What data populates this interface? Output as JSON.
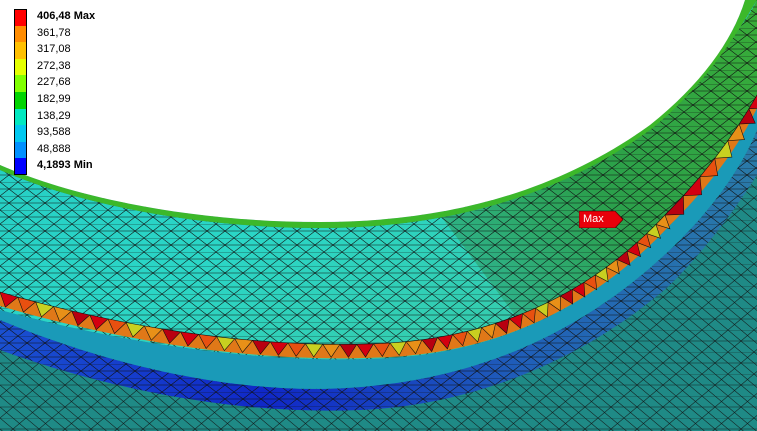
{
  "legend": {
    "entries": [
      {
        "label": "406,48 Max",
        "color": "#ff0000",
        "bold": true
      },
      {
        "label": "361,78",
        "color": "#ff8c00",
        "bold": false
      },
      {
        "label": "317,08",
        "color": "#ffc000",
        "bold": false
      },
      {
        "label": "272,38",
        "color": "#e5ff00",
        "bold": false
      },
      {
        "label": "227,68",
        "color": "#80ff00",
        "bold": false
      },
      {
        "label": "182,99",
        "color": "#00d400",
        "bold": false
      },
      {
        "label": "138,29",
        "color": "#00e8c0",
        "bold": false
      },
      {
        "label": "93,588",
        "color": "#00c8f0",
        "bold": false
      },
      {
        "label": "48,888",
        "color": "#0090ff",
        "bold": false
      },
      {
        "label": "4,1893 Min",
        "color": "#0000ff",
        "bold": true
      }
    ]
  },
  "probe": {
    "max_label": "Max",
    "color": "#e8000a"
  },
  "colors": {
    "background": "#ffffff",
    "mesh_line": "#101010",
    "outer_region": "#1f8a86",
    "blue_band": "#1040c8",
    "inner_face": "#2ad0cc",
    "green_ring": "#2a9a18",
    "hot_ring": "#d03020"
  }
}
